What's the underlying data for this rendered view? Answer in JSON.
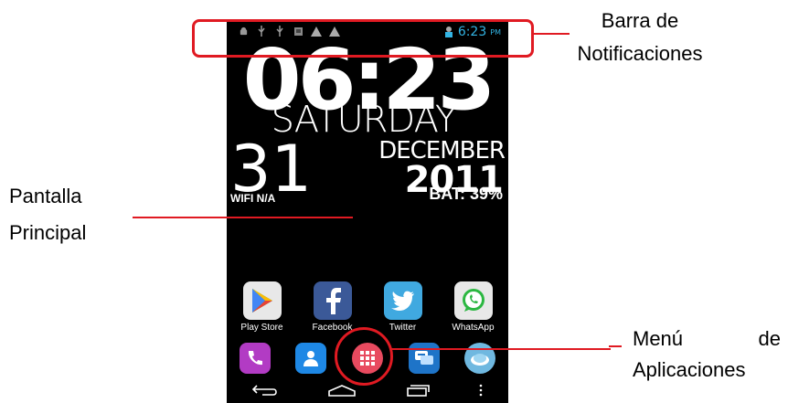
{
  "status_bar": {
    "time": "6:23",
    "ampm": "PM",
    "icons": [
      "android-debug-icon",
      "usb-icon",
      "usb-icon",
      "sd-card-icon",
      "warning-icon",
      "warning-icon",
      "profile-icon"
    ]
  },
  "clock_widget": {
    "time": "06:23",
    "day": "SATURDAY",
    "date": "31",
    "month": "DECEMBER",
    "year": "2011",
    "wifi": "WIFI N/A",
    "battery": "BAT: 39%"
  },
  "apps": [
    {
      "label": "Play Store",
      "icon": "play-store-icon",
      "color": "#e8e8e8"
    },
    {
      "label": "Facebook",
      "icon": "facebook-icon",
      "color": "#3b5998"
    },
    {
      "label": "Twitter",
      "icon": "twitter-icon",
      "color": "#40a9e0"
    },
    {
      "label": "WhatsApp",
      "icon": "whatsapp-icon",
      "color": "#e8e8e8"
    }
  ],
  "dock": [
    {
      "icon": "phone-icon",
      "color": "#b23bc4"
    },
    {
      "icon": "contacts-icon",
      "color": "#1e88e5"
    },
    {
      "icon": "app-drawer-icon",
      "color": "#e84a5f"
    },
    {
      "icon": "messaging-icon",
      "color": "#1e74c8"
    },
    {
      "icon": "browser-icon",
      "color": "#6fb8e0"
    }
  ],
  "navigation": [
    "back-icon",
    "home-icon",
    "recent-apps-icon",
    "menu-icon"
  ],
  "annotations": {
    "notification_bar_line1": "Barra de",
    "notification_bar_line2": "Notificaciones",
    "main_screen_line1": "Pantalla",
    "main_screen_line2": "Principal",
    "apps_menu_line1_a": "Menú",
    "apps_menu_line1_b": "de",
    "apps_menu_line2": "Aplicaciones"
  },
  "colors": {
    "callout_red": "#e01a22",
    "status_accent": "#33b5e5"
  }
}
